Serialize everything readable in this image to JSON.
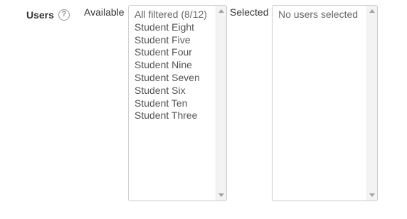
{
  "field": {
    "label": "Users",
    "help_icon": "question-circle-icon",
    "help_glyph": "?"
  },
  "available": {
    "label": "Available",
    "options": [
      "All filtered (8/12)",
      "Student Eight",
      "Student Five",
      "Student Four",
      "Student Nine",
      "Student Seven",
      "Student Six",
      "Student Ten",
      "Student Three"
    ]
  },
  "selected": {
    "label": "Selected",
    "options": [
      "No users selected"
    ]
  },
  "colors": {
    "border": "#cccccc",
    "text": "#555555",
    "label": "#333333",
    "icon": "#999999"
  }
}
